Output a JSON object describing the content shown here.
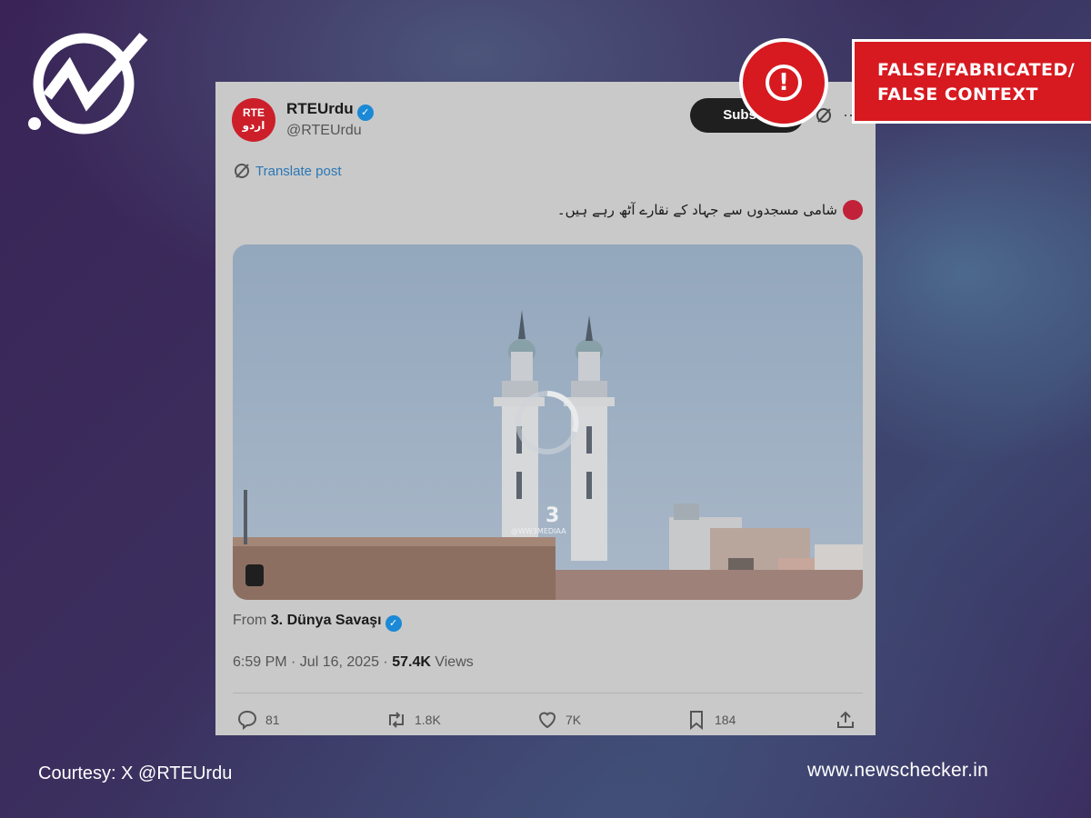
{
  "brand": {
    "logo_icon": "newschecker-check-icon"
  },
  "verdict": {
    "icon": "exclamation-alert-icon",
    "line1": "FALSE/FABRICATED/",
    "line2": "FALSE CONTEXT",
    "color": "#d71920"
  },
  "tweet": {
    "avatar_line1": "RTE",
    "avatar_line2": "اردو",
    "account_name": "RTEUrdu",
    "verified_icon": "verified-badge-icon",
    "handle": "@RTEUrdu",
    "subscribe_label": "Subscribe",
    "translate_label": "Translate post",
    "text": "شامی مسجدوں سے جہاد کے نقارے آٹھ رہے ہیں۔",
    "media": {
      "watermark_number": "3",
      "watermark_text": "@WW3MEDIAA"
    },
    "from_prefix": "From",
    "from_source": "3. Dünya Savaşı",
    "time": "6:59 PM · Jul 16, 2025 · ",
    "views_count": "57.4K",
    "views_label": " Views",
    "actions": {
      "replies": "81",
      "reposts": "1.8K",
      "likes": "7K",
      "bookmarks": "184"
    }
  },
  "footer": {
    "courtesy": "Courtesy: X @RTEUrdu",
    "site": "www.newschecker.in"
  }
}
